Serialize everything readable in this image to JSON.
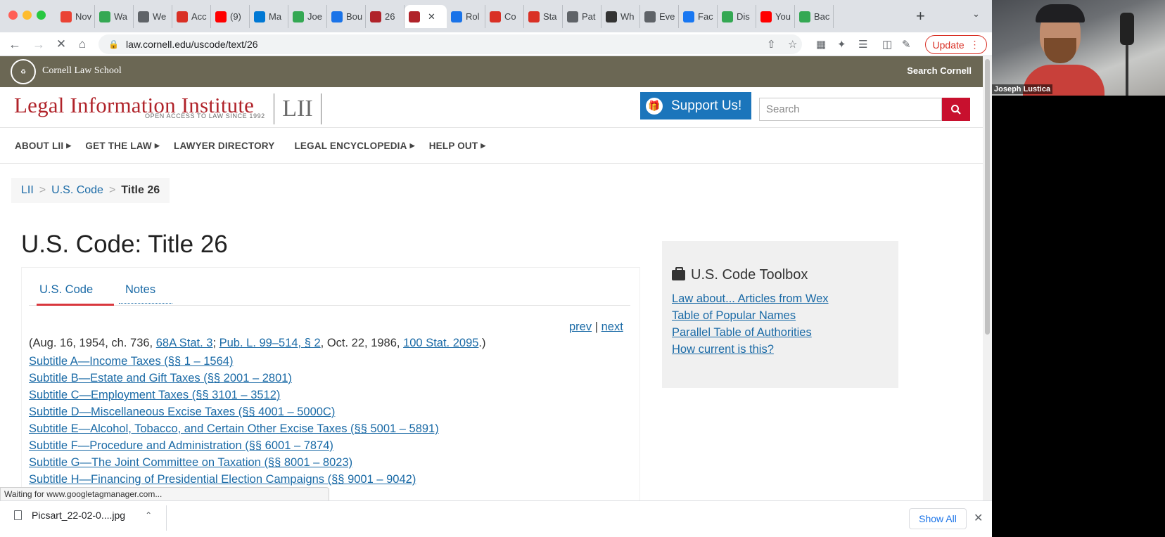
{
  "colors": {
    "cornell_bar": "#6b6754",
    "lii_red": "#b0232a",
    "support_blue": "#1b75bb",
    "search_red": "#c8102e",
    "link_blue": "#1a6aa6",
    "active_tab_underline": "#d9383e",
    "update_red": "#d93025"
  },
  "browser": {
    "tabs": [
      {
        "label": "Nov",
        "favicon": "gmail-icon",
        "color": "#ea4335"
      },
      {
        "label": "Wa",
        "favicon": "google-sheets-icon",
        "color": "#34a853"
      },
      {
        "label": "We",
        "favicon": "globe-icon",
        "color": "#5f6368"
      },
      {
        "label": "Acc",
        "favicon": "site-icon",
        "color": "#d93025"
      },
      {
        "label": "(9)",
        "favicon": "youtube-icon",
        "color": "#ff0000"
      },
      {
        "label": "Ma",
        "favicon": "outlook-icon",
        "color": "#0078d4"
      },
      {
        "label": "Joe",
        "favicon": "site-icon",
        "color": "#34a853"
      },
      {
        "label": "Bou",
        "favicon": "site-icon",
        "color": "#1a73e8"
      },
      {
        "label": "26",
        "favicon": "lii-icon",
        "color": "#b0232a"
      },
      {
        "label": "",
        "favicon": "lii-icon",
        "color": "#b0232a",
        "active": true
      },
      {
        "label": "Rol",
        "favicon": "site-icon",
        "color": "#1a73e8"
      },
      {
        "label": "Co",
        "favicon": "site-icon",
        "color": "#d93025"
      },
      {
        "label": "Sta",
        "favicon": "bar-chart-icon",
        "color": "#d93025"
      },
      {
        "label": "Pat",
        "favicon": "globe-icon",
        "color": "#5f6368"
      },
      {
        "label": "Wh",
        "favicon": "site-icon",
        "color": "#333333"
      },
      {
        "label": "Eve",
        "favicon": "globe-icon",
        "color": "#5f6368"
      },
      {
        "label": "Fac",
        "favicon": "facebook-icon",
        "color": "#1877f2"
      },
      {
        "label": "Dis",
        "favicon": "google-sheets-icon",
        "color": "#34a853"
      },
      {
        "label": "You",
        "favicon": "youtube-icon",
        "color": "#ff0000"
      },
      {
        "label": "Bac",
        "favicon": "google-sheets-icon",
        "color": "#34a853"
      }
    ],
    "url": "law.cornell.edu/uscode/text/26",
    "update_label": "Update"
  },
  "page": {
    "cornell_name": "Cornell Law School",
    "search_cornell": "Search Cornell",
    "lii_title": "Legal Information Institute",
    "lii_tagline": "OPEN ACCESS TO LAW SINCE 1992",
    "lii_mark": "LII",
    "support_label": "Support Us!",
    "search_placeholder": "Search",
    "nav": [
      {
        "label": "ABOUT LII",
        "caret": true
      },
      {
        "label": "GET THE LAW",
        "caret": true
      },
      {
        "label": "LAWYER DIRECTORY",
        "caret": false
      },
      {
        "label": "LEGAL ENCYCLOPEDIA",
        "caret": true
      },
      {
        "label": "HELP OUT",
        "caret": true
      }
    ],
    "breadcrumb": {
      "items": [
        "LII",
        "U.S. Code"
      ],
      "current": "Title 26"
    },
    "title": "U.S. Code: Title 26",
    "content_tabs": {
      "uscode": "U.S. Code",
      "notes": "Notes"
    },
    "prev": "prev",
    "next": "next",
    "prevnext_sep": "|",
    "source": {
      "p1": "(Aug. 16, 1954, ch. 736, ",
      "l1": "68A Stat. 3",
      "p2": "; ",
      "l2": "Pub. L. 99–514, § 2",
      "p3": ", Oct. 22, 1986, ",
      "l3": "100 Stat. 2095",
      "p4": ".)"
    },
    "subtitles": [
      "Subtitle A—Income Taxes (§§ 1 – 1564)",
      "Subtitle B—Estate and Gift Taxes (§§ 2001 – 2801)",
      "Subtitle C—Employment Taxes (§§ 3101 – 3512)",
      "Subtitle D—Miscellaneous Excise Taxes (§§ 4001 – 5000C)",
      "Subtitle E—Alcohol, Tobacco, and Certain Other Excise Taxes (§§ 5001 – 5891)",
      "Subtitle F—Procedure and Administration (§§ 6001 – 7874)",
      "Subtitle G—The Joint Committee on Taxation (§§ 8001 – 8023)",
      "Subtitle H—Financing of Presidential Election Campaigns (§§ 9001 – 9042)"
    ],
    "toolbox": {
      "title": "U.S. Code Toolbox",
      "links": [
        "Law about... Articles from Wex",
        "Table of Popular Names",
        "Parallel Table of Authorities",
        "How current is this?"
      ]
    }
  },
  "status_text": "Waiting for www.googletagmanager.com...",
  "download": {
    "file": "Picsart_22-02-0....jpg",
    "show_all": "Show All"
  },
  "webcam": {
    "name": "Joseph Lustica"
  }
}
